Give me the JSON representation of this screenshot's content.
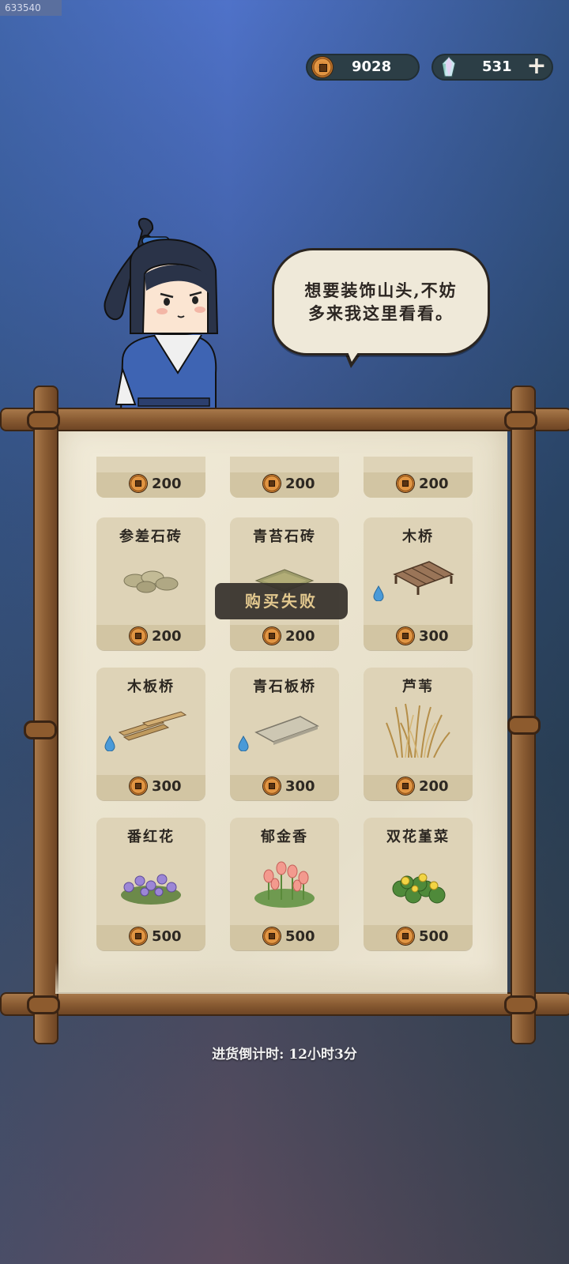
{
  "header": {
    "id_tag": "633540",
    "coins": "9028",
    "gems": "531",
    "add_label": "+"
  },
  "npc": {
    "speech_line1": "想要装饰山头,不妨",
    "speech_line2": "多来我这里看看。"
  },
  "shop": {
    "partial_row": [
      {
        "price": "200"
      },
      {
        "price": "200"
      },
      {
        "price": "200"
      }
    ],
    "items": [
      {
        "name": "参差石砖",
        "price": "200",
        "icon": "stone-slabs",
        "water": false
      },
      {
        "name": "青苔石砖",
        "price": "200",
        "icon": "moss-stone-tile",
        "water": false
      },
      {
        "name": "木桥",
        "price": "300",
        "icon": "wooden-bridge",
        "water": true
      },
      {
        "name": "木板桥",
        "price": "300",
        "icon": "plank-bridge",
        "water": true
      },
      {
        "name": "青石板桥",
        "price": "300",
        "icon": "bluestone-bridge",
        "water": true
      },
      {
        "name": "芦苇",
        "price": "200",
        "icon": "reeds",
        "water": false
      },
      {
        "name": "番红花",
        "price": "500",
        "icon": "crocus",
        "water": false
      },
      {
        "name": "郁金香",
        "price": "500",
        "icon": "tulip",
        "water": false
      },
      {
        "name": "双花堇菜",
        "price": "500",
        "icon": "violet",
        "water": false
      }
    ],
    "toast": "购买失败",
    "timer": "进货倒计时: 12小时3分"
  },
  "colors": {
    "parchment": "#ebe4cf",
    "card": "#ded3b7",
    "wood": "#8a5c33",
    "toast_text": "#e2c88e"
  }
}
